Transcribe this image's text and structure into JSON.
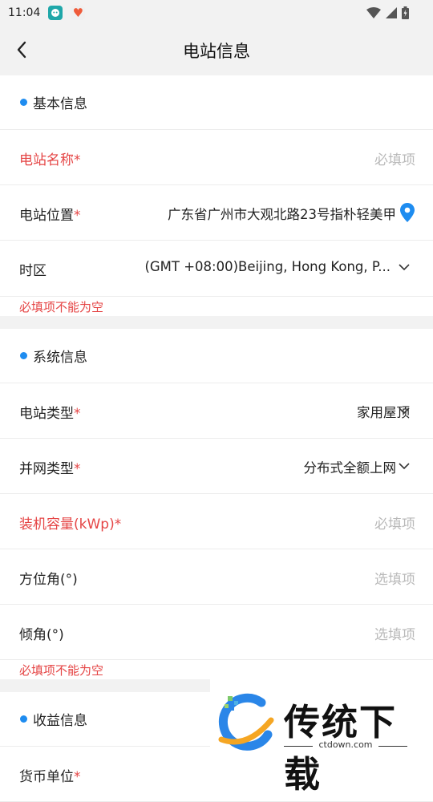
{
  "status_bar": {
    "time": "11:04"
  },
  "header": {
    "title": "电站信息"
  },
  "basic": {
    "title": "基本信息",
    "name_label": "电站名称",
    "name_placeholder": "必填项",
    "location_label": "电站位置",
    "location_value": "广东省广州市大观北路23号指朴轻美甲",
    "timezone_label": "时区",
    "timezone_value": "(GMT +08:00)Beijing, Hong Kong, P...",
    "error": "必填项不能为空"
  },
  "system": {
    "title": "系统信息",
    "type_label": "电站类型",
    "type_value": "家用屋顶",
    "grid_label": "并网类型",
    "grid_value": "分布式全额上网",
    "capacity_label": "装机容量(kWp)",
    "capacity_placeholder": "必填项",
    "azimuth_label": "方位角(°)",
    "azimuth_placeholder": "选填项",
    "tilt_label": "倾角(°)",
    "tilt_placeholder": "选填项",
    "error": "必填项不能为空"
  },
  "income": {
    "title": "收益信息",
    "next_label": "货币单位"
  },
  "required_mark": "*",
  "watermark": {
    "text": "传统下载",
    "url": "ctdown.com"
  },
  "colors": {
    "accent": "#1e8cf0",
    "error": "#e54545",
    "placeholder": "#b9b9b9",
    "background": "#f2f2f2"
  }
}
